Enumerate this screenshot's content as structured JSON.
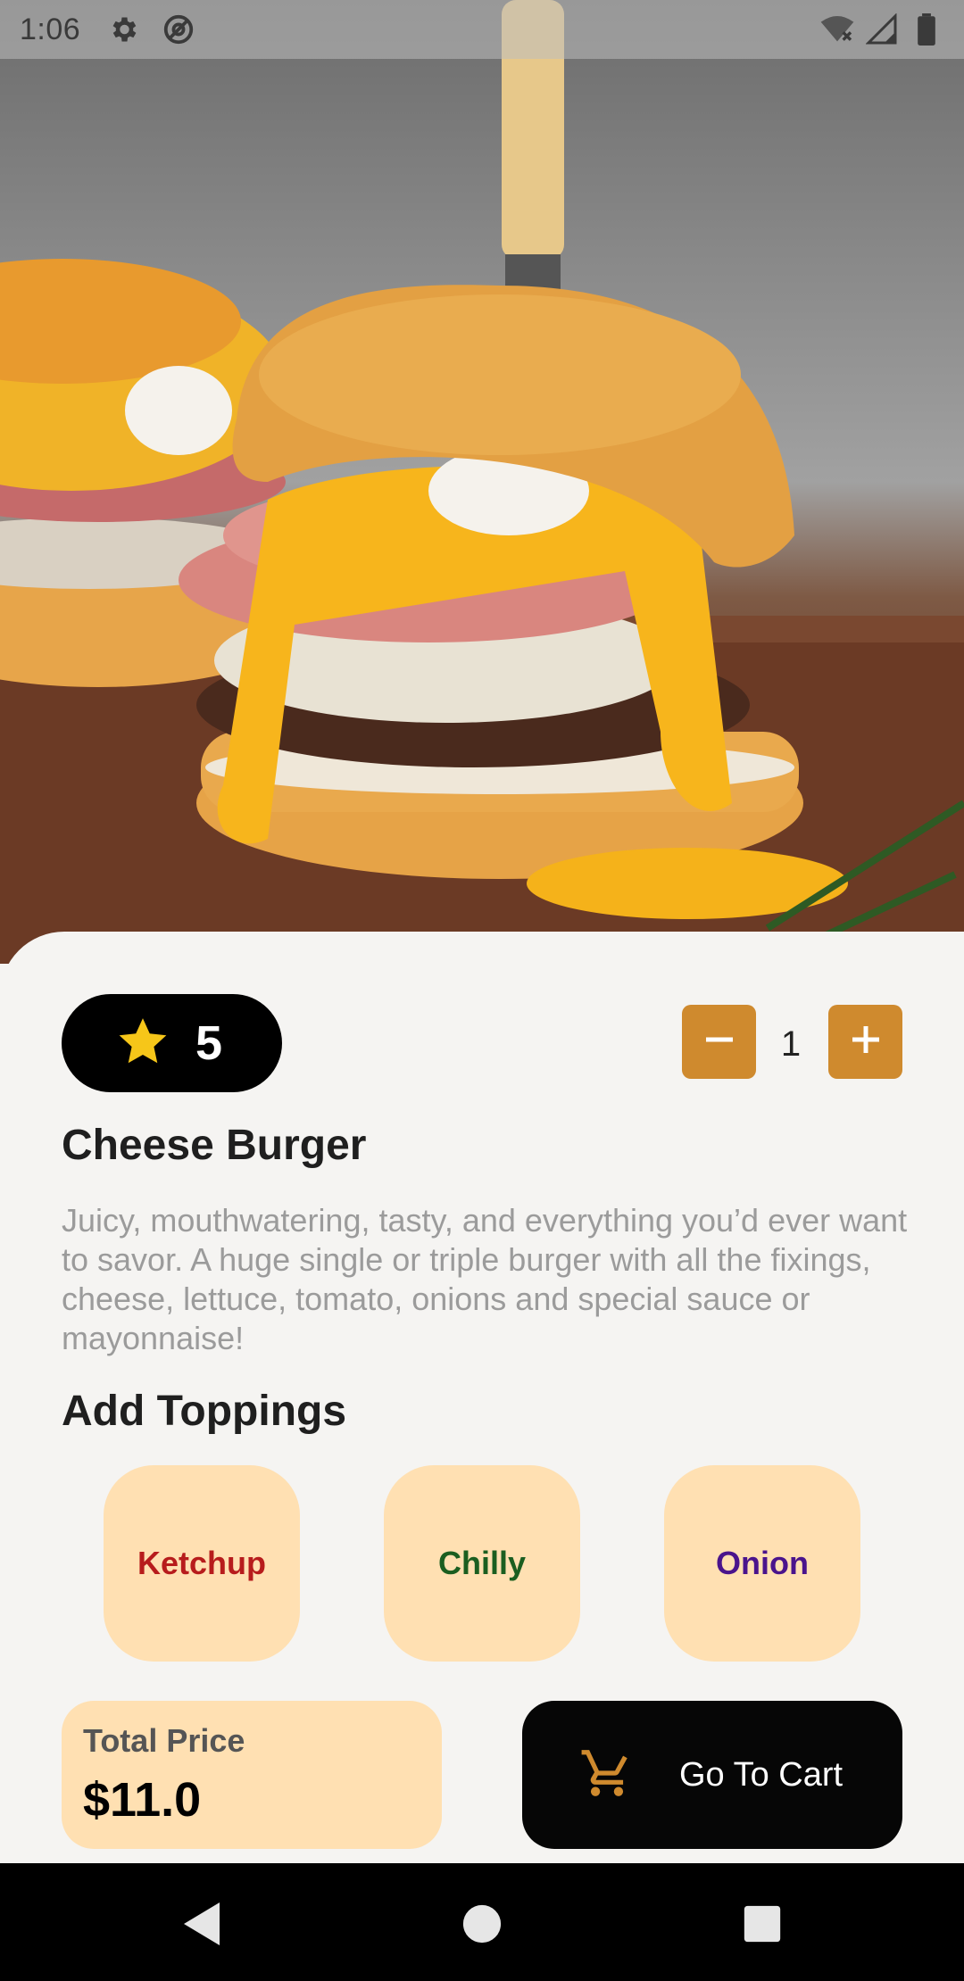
{
  "status_bar": {
    "time": "1:06",
    "icons": [
      "gear-icon",
      "at-icon",
      "wifi-off-icon",
      "signal-icon",
      "battery-icon"
    ]
  },
  "hero": {
    "image": "cheese-burger-photo"
  },
  "product": {
    "rating": "5",
    "quantity": "1",
    "title": "Cheese Burger",
    "description": "Juicy, mouthwatering, tasty, and everything you’d ever want to savor. A huge single or triple burger with all the fixings, cheese, lettuce, tomato, onions and special sauce or mayonnaise!"
  },
  "toppings": {
    "heading": "Add Toppings",
    "items": [
      {
        "label": "Ketchup",
        "color": "#b71c1c"
      },
      {
        "label": "Chilly",
        "color": "#1b5e20"
      },
      {
        "label": "Onion",
        "color": "#4a148c"
      }
    ]
  },
  "footer": {
    "total_label": "Total Price",
    "total_value": "$11.0",
    "cart_label": "Go To Cart"
  },
  "colors": {
    "accent": "#cf8a2e",
    "chip_bg": "#ffe0b2",
    "dark": "#000000",
    "background": "#f5f4f2"
  },
  "nav": {
    "icons": [
      "back-icon",
      "home-icon",
      "recents-icon"
    ]
  }
}
